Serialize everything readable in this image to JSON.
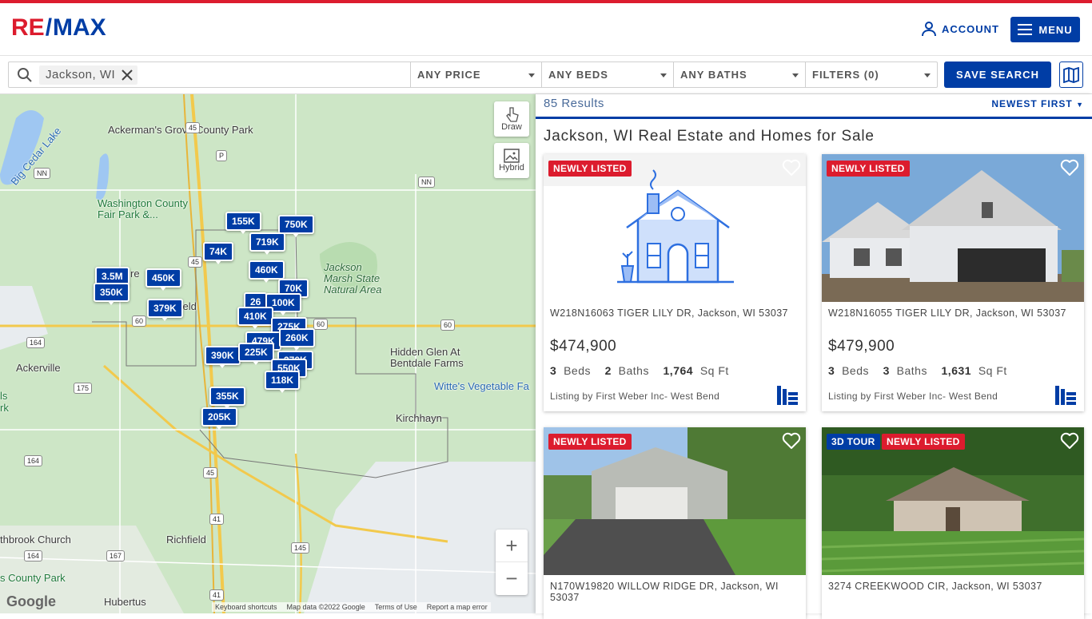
{
  "brand": {
    "logo_left": "RE",
    "logo_slash": "/",
    "logo_right": "MAX",
    "accent": "#dc1c2e",
    "primary": "#003da5"
  },
  "header": {
    "account_label": "ACCOUNT",
    "menu_label": "MENU"
  },
  "filters": {
    "search_value": "Jackson, WI",
    "price": "ANY PRICE",
    "beds": "ANY BEDS",
    "baths": "ANY BATHS",
    "more": "FILTERS (0)",
    "save_search": "SAVE SEARCH"
  },
  "map": {
    "draw_label": "Draw",
    "hybrid_label": "Hybrid",
    "labels": [
      "Ackerman's Grove County Park",
      "Big Cedar Lake",
      "Washington County Fair Park &...",
      "Jackson Marsh State Natural Area",
      "Hidden Glen At Bentdale Farms",
      "Witte's Vegetable Fa",
      "Ackerville",
      "Kirchhayn",
      "Richfield",
      "Hubertus",
      "thbrook Church",
      "s County Park",
      "ls",
      "rk",
      "re",
      "field"
    ],
    "roads": [
      "NN",
      "45",
      "P",
      "NN",
      "45",
      "60",
      "164",
      "60",
      "60",
      "175",
      "164",
      "45",
      "41",
      "145",
      "167",
      "164",
      "41",
      "NN"
    ],
    "pins": [
      "155K",
      "750K",
      "719K",
      "74K",
      "3.5M",
      "450K",
      "460K",
      "350K",
      "70K",
      "379K",
      "26",
      "100K",
      "410K",
      "275K",
      "479K",
      "260K",
      "390K",
      "225K",
      "370K",
      "550K",
      "118K",
      "355K",
      "205K"
    ],
    "footer": {
      "keyboard": "Keyboard shortcuts",
      "mapdata": "Map data ©2022 Google",
      "terms": "Terms of Use",
      "report": "Report a map error"
    },
    "google": "Google"
  },
  "results": {
    "count": "85 Results",
    "sort": "NEWEST FIRST",
    "title": "Jackson, WI Real Estate and Homes for Sale",
    "listings": [
      {
        "badge1": "NEWLY LISTED",
        "address": "W218N16063 TIGER LILY DR, Jackson, WI 53037",
        "price": "$474,900",
        "beds": "3",
        "beds_label": "Beds",
        "baths": "2",
        "baths_label": "Baths",
        "sqft": "1,764",
        "sqft_label": "Sq Ft",
        "broker": "Listing by First Weber Inc- West Bend"
      },
      {
        "badge1": "NEWLY LISTED",
        "address": "W218N16055 TIGER LILY DR, Jackson, WI 53037",
        "price": "$479,900",
        "beds": "3",
        "beds_label": "Beds",
        "baths": "3",
        "baths_label": "Baths",
        "sqft": "1,631",
        "sqft_label": "Sq Ft",
        "broker": "Listing by First Weber Inc- West Bend"
      },
      {
        "badge1": "NEWLY LISTED",
        "address": "N170W19820 WILLOW RIDGE DR, Jackson, WI 53037"
      },
      {
        "badge0": "3D TOUR",
        "badge1": "NEWLY LISTED",
        "address": "3274 CREEKWOOD CIR, Jackson, WI 53037"
      }
    ]
  }
}
